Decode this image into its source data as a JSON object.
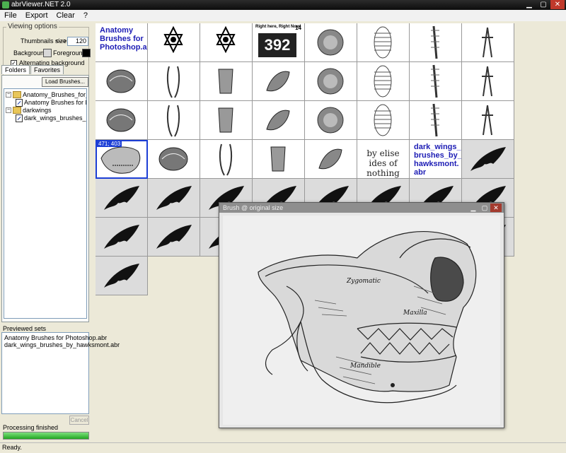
{
  "app": {
    "title": "abrViewer.NET 2.0"
  },
  "menu": [
    "File",
    "Export",
    "Clear",
    "?"
  ],
  "options": {
    "group_title": "Viewing options",
    "thumb_size_label": "Thumbnails size:",
    "thumb_arrow": "<-->",
    "thumb_size_value": "120",
    "background_label": "Background:",
    "foreground_label": "Foreground:",
    "alt_bg_label": "Alternating background",
    "alt_bg_checked": "✓"
  },
  "tabs": [
    "Folders",
    "Favorites"
  ],
  "load_button": "Load Brushes...",
  "tree": [
    {
      "label": "Anatomy_Brushes_for_PS",
      "expander": "−"
    },
    {
      "label": "Anatomy Brushes for Photoshop.abr"
    },
    {
      "label": "darkwings",
      "expander": "−"
    },
    {
      "label": "dark_wings_brushes_by_hawksmont.abr"
    }
  ],
  "previewed": {
    "label": "Previewed sets",
    "items": [
      "Anatomy Brushes for Photoshop.abr",
      "dark_wings_brushes_by_hawksmont.abr"
    ]
  },
  "cancel_button": "Cancel",
  "processing": {
    "label": "Processing finished",
    "progress": 1.0
  },
  "status": "Ready.",
  "grid": {
    "set_label_1": "Anatomy Brushes for Photoshop.abr",
    "set_label_2": "dark_wings_ brushes_by_ hawksmont. abr",
    "brush_text": "by elise ides of nothing",
    "brush_sign_top": "Right here, Right Now!",
    "brush_sign_num": "14",
    "brush_sign_big": "392",
    "selected_coord": "471; 403"
  },
  "popup": {
    "title": "Brush @ original size",
    "labels": {
      "zygomatic": "Zygomatic",
      "maxilla": "Maxilla",
      "mandible": "Mandible"
    }
  }
}
